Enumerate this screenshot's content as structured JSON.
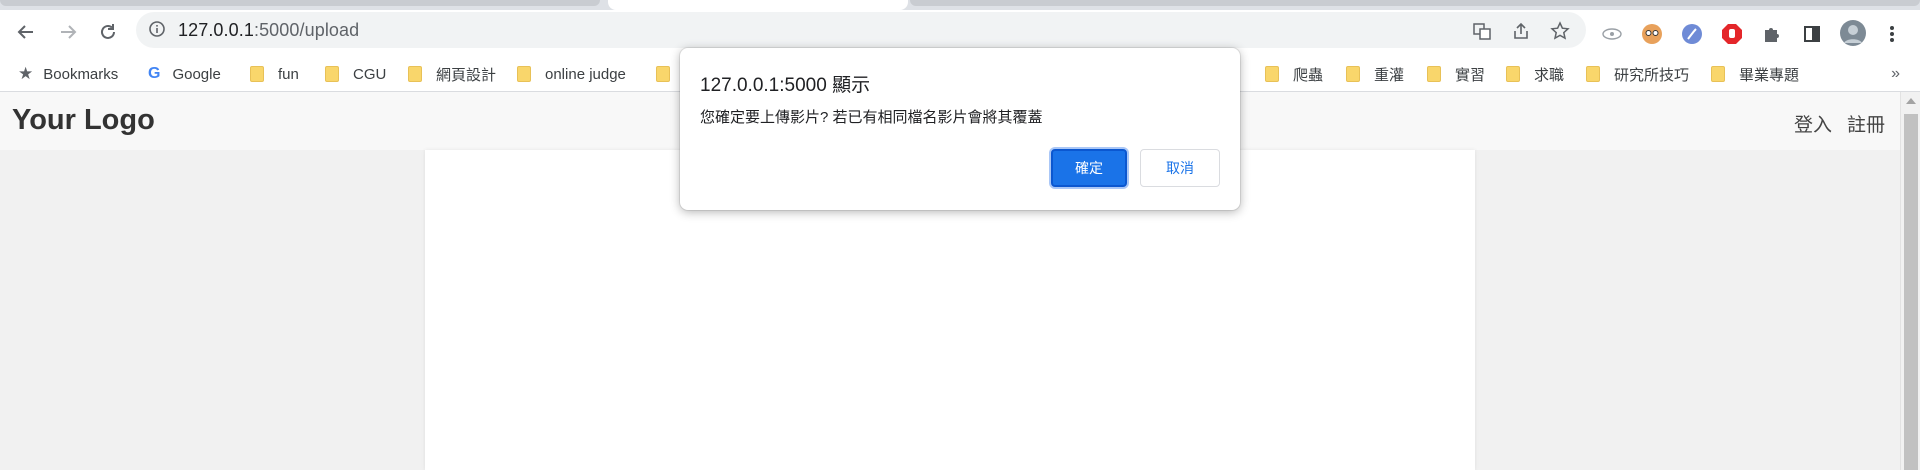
{
  "browser": {
    "url_host": "127.0.0.1",
    "url_path": ":5000/upload"
  },
  "bookmarks": {
    "bookmarks_label": "Bookmarks",
    "items": [
      "Google",
      "fun",
      "CGU",
      "網頁設計",
      "online judge",
      "",
      "爬蟲",
      "重灌",
      "實習",
      "求職",
      "研究所技巧",
      "畢業專題"
    ],
    "more": "»"
  },
  "page": {
    "logo": "Your Logo",
    "login": "登入",
    "register": "註冊"
  },
  "dialog": {
    "title": "127.0.0.1:5000 顯示",
    "message": "您確定要上傳影片? 若已有相同檔名影片會將其覆蓋",
    "ok_label": "確定",
    "cancel_label": "取消"
  },
  "colors": {
    "accent": "#1a73e8",
    "folder": "#f9d66b"
  }
}
